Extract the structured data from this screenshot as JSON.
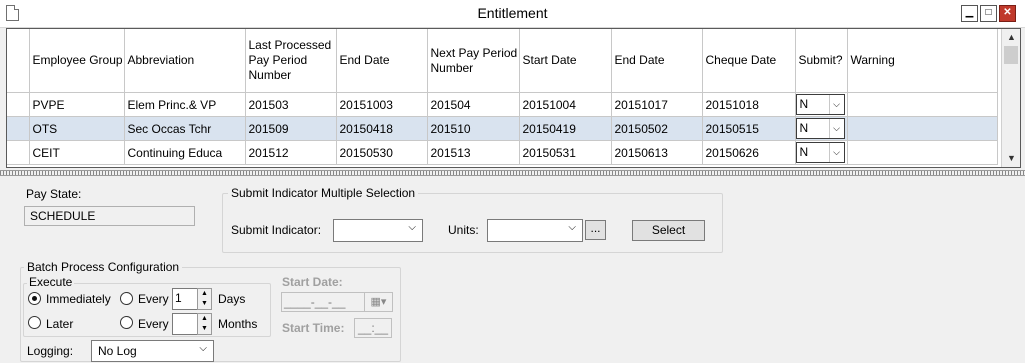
{
  "window": {
    "title": "Entitlement"
  },
  "grid": {
    "columns": [
      "Employee Group",
      "Abbreviation",
      "Last Processed Pay Period Number",
      "End Date",
      "Next Pay Period Number",
      "Start Date",
      "End Date",
      "Cheque Date",
      "Submit?",
      "Warning"
    ],
    "rows": [
      {
        "group": "PVPE",
        "abbr": "Elem Princ.& VP",
        "last": "201503",
        "end1": "20151003",
        "next": "201504",
        "start": "20151004",
        "end2": "20151017",
        "cheque": "20151018",
        "submit": "N",
        "warning": ""
      },
      {
        "group": "OTS",
        "abbr": "Sec Occas Tchr",
        "last": "201509",
        "end1": "20150418",
        "next": "201510",
        "start": "20150419",
        "end2": "20150502",
        "cheque": "20150515",
        "submit": "N",
        "warning": ""
      },
      {
        "group": "CEIT",
        "abbr": "Continuing Educa",
        "last": "201512",
        "end1": "20150530",
        "next": "201513",
        "start": "20150531",
        "end2": "20150613",
        "cheque": "20150626",
        "submit": "N",
        "warning": ""
      }
    ]
  },
  "pay_state": {
    "label": "Pay State:",
    "value": "SCHEDULE"
  },
  "submit_multi": {
    "legend": "Submit Indicator Multiple Selection",
    "submit_indicator_label": "Submit Indicator:",
    "submit_indicator_value": "",
    "units_label": "Units:",
    "units_value": "",
    "ellipsis": "...",
    "select_button": "Select"
  },
  "batch": {
    "legend": "Batch Process Configuration",
    "execute_legend": "Execute",
    "immediately": "Immediately",
    "later": "Later",
    "every1": "Every",
    "every1_value": "1",
    "days": "Days",
    "every2": "Every",
    "every2_value": "",
    "months": "Months",
    "start_date_label": "Start Date:",
    "start_date_value": "____-__-__",
    "start_time_label": "Start Time:",
    "start_time_value": "__:__"
  },
  "logging": {
    "label": "Logging:",
    "value": "No Log"
  }
}
